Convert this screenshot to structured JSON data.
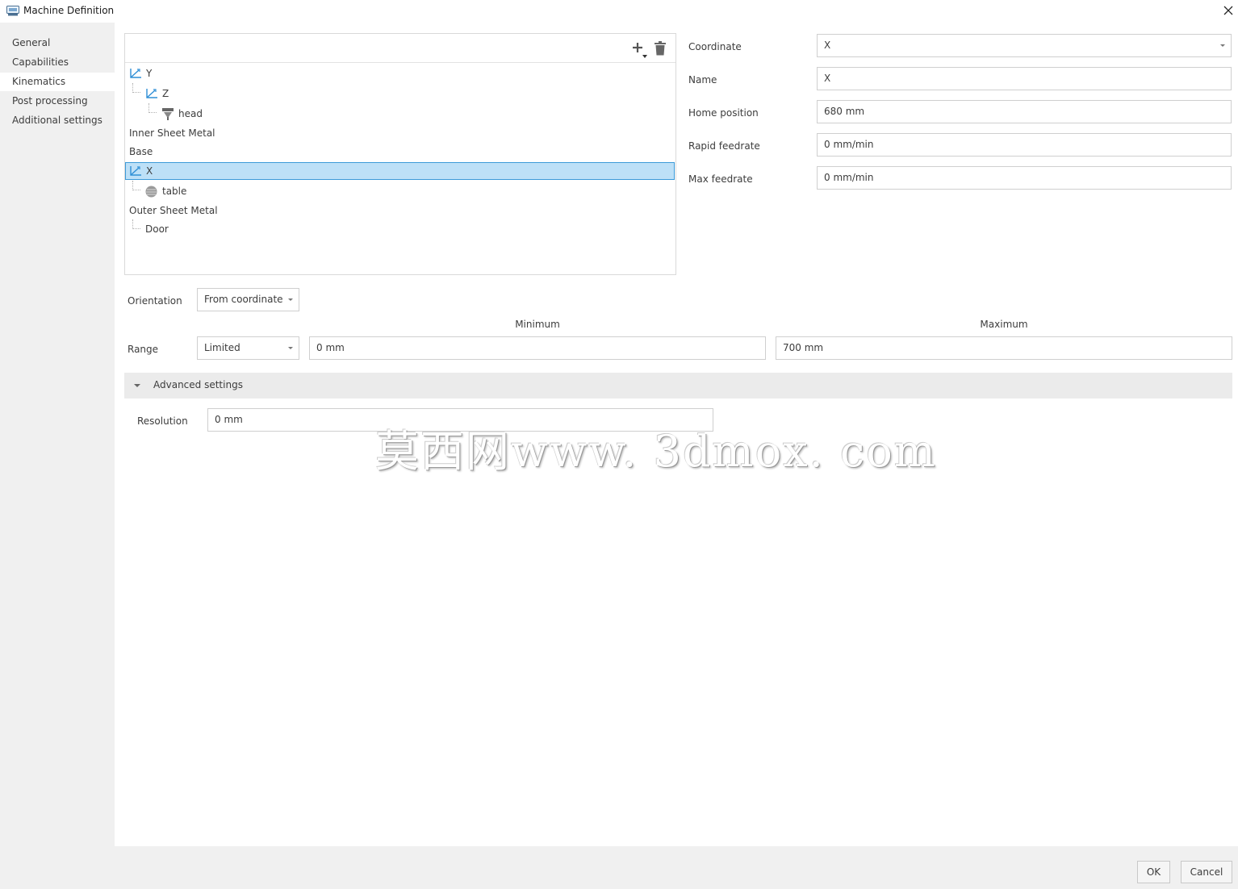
{
  "window": {
    "title": "Machine Definition"
  },
  "sidebar": {
    "items": [
      {
        "label": "General",
        "active": false
      },
      {
        "label": "Capabilities",
        "active": false
      },
      {
        "label": "Kinematics",
        "active": true
      },
      {
        "label": "Post processing",
        "active": false
      },
      {
        "label": "Additional settings",
        "active": false
      }
    ]
  },
  "tree": {
    "nodes": [
      {
        "label": "Y",
        "icon": "axis-icon"
      },
      {
        "label": "Z",
        "icon": "axis-icon"
      },
      {
        "label": "head",
        "icon": "spindle-head-icon"
      },
      {
        "label": "Inner Sheet Metal",
        "icon": ""
      },
      {
        "label": "Base",
        "icon": ""
      },
      {
        "label": "X",
        "icon": "axis-icon",
        "selected": true
      },
      {
        "label": "table",
        "icon": "table-icon"
      },
      {
        "label": "Outer Sheet Metal",
        "icon": ""
      },
      {
        "label": "Door",
        "icon": ""
      }
    ]
  },
  "properties": {
    "coordinate": {
      "label": "Coordinate",
      "value": "X"
    },
    "name": {
      "label": "Name",
      "value": "X"
    },
    "home_position": {
      "label": "Home position",
      "value": "680 mm"
    },
    "rapid_feedrate": {
      "label": "Rapid feedrate",
      "value": "0 mm/min"
    },
    "max_feedrate": {
      "label": "Max feedrate",
      "value": "0 mm/min"
    }
  },
  "orientation": {
    "label": "Orientation",
    "value": "From coordinate"
  },
  "range": {
    "label": "Range",
    "mode": "Limited",
    "minimum_label": "Minimum",
    "minimum_value": "0 mm",
    "maximum_label": "Maximum",
    "maximum_value": "700 mm"
  },
  "advanced": {
    "label": "Advanced settings",
    "resolution_label": "Resolution",
    "resolution_value": "0 mm"
  },
  "watermark": "莫西网www. 3dmox. com",
  "footer": {
    "ok_label": "OK",
    "cancel_label": "Cancel"
  },
  "colors": {
    "selection_bg": "#bde0f7",
    "selection_border": "#3c9ad8",
    "axis_icon": "#2f8fd6"
  }
}
